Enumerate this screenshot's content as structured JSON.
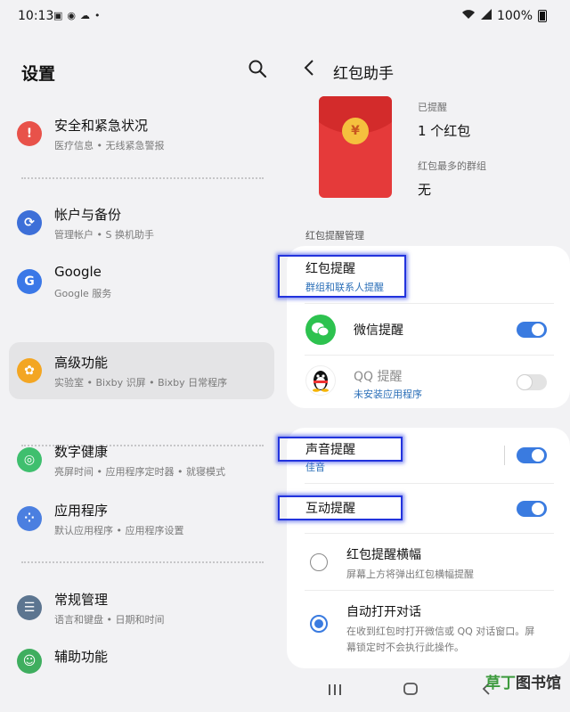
{
  "status_bar": {
    "time": "10:13",
    "battery": "100%",
    "left_icons": [
      "gallery-icon",
      "ca-icon",
      "cloud-icon",
      "dot-icon"
    ],
    "right_icons": [
      "wifi-icon",
      "signal-icon",
      "battery-icon"
    ]
  },
  "settings": {
    "title": "设置",
    "items": [
      {
        "title": "安全和紧急状况",
        "sub": "医疗信息 • 无线紧急警报",
        "icon": "emergency-icon",
        "color": "#e8524a"
      },
      {
        "title": "帐户与备份",
        "sub": "管理帐户 • S 换机助手",
        "icon": "sync-icon",
        "color": "#3d6fd8"
      },
      {
        "title": "Google",
        "sub": "Google 服务",
        "icon": "google-icon",
        "color": "#3b78e7"
      },
      {
        "title": "高级功能",
        "sub": "实验室 • Bixby 识屏 • Bixby 日常程序",
        "icon": "gear-plus-icon",
        "color": "#f3a623"
      },
      {
        "title": "数字健康",
        "sub": "亮屏时间 • 应用程序定时器 • 就寝模式",
        "icon": "wellbeing-icon",
        "color": "#3fbf6e"
      },
      {
        "title": "应用程序",
        "sub": "默认应用程序 • 应用程序设置",
        "icon": "apps-icon",
        "color": "#4b7fe0"
      },
      {
        "title": "常规管理",
        "sub": "语言和键盘 • 日期和时间",
        "icon": "sliders-icon",
        "color": "#5c7590"
      },
      {
        "title": "辅助功能",
        "sub": "",
        "icon": "accessibility-icon",
        "color": "#3fae5f"
      }
    ]
  },
  "detail": {
    "title": "红包助手",
    "coin_symbol": "¥",
    "reminded_label": "已提醒",
    "reminded_value": "1 个红包",
    "top_group_label": "红包最多的群组",
    "top_group_value": "无",
    "section_label": "红包提醒管理",
    "alert": {
      "title": "红包提醒",
      "sub": "群组和联系人提醒"
    },
    "wechat": {
      "title": "微信提醒",
      "enabled": true
    },
    "qq": {
      "title": "QQ 提醒",
      "sub": "未安装应用程序",
      "enabled": false
    },
    "sound": {
      "title": "声音提醒",
      "sub": "佳音",
      "enabled": true
    },
    "interactive": {
      "title": "互动提醒",
      "enabled": true
    },
    "options": [
      {
        "title": "红包提醒横幅",
        "desc": "屏幕上方将弹出红包横幅提醒",
        "selected": false
      },
      {
        "title": "自动打开对话",
        "desc_line1": "在收到红包时打开微信或 QQ 对话窗口。屏",
        "desc_line2": "幕锁定时不会执行此操作。",
        "selected": true
      }
    ]
  },
  "watermark": {
    "prefix": "草丁",
    "suffix": "图书馆"
  },
  "colors": {
    "accent": "#3a7be0",
    "highlight_box": "#2233dd",
    "envelope": "#e53a3a"
  }
}
